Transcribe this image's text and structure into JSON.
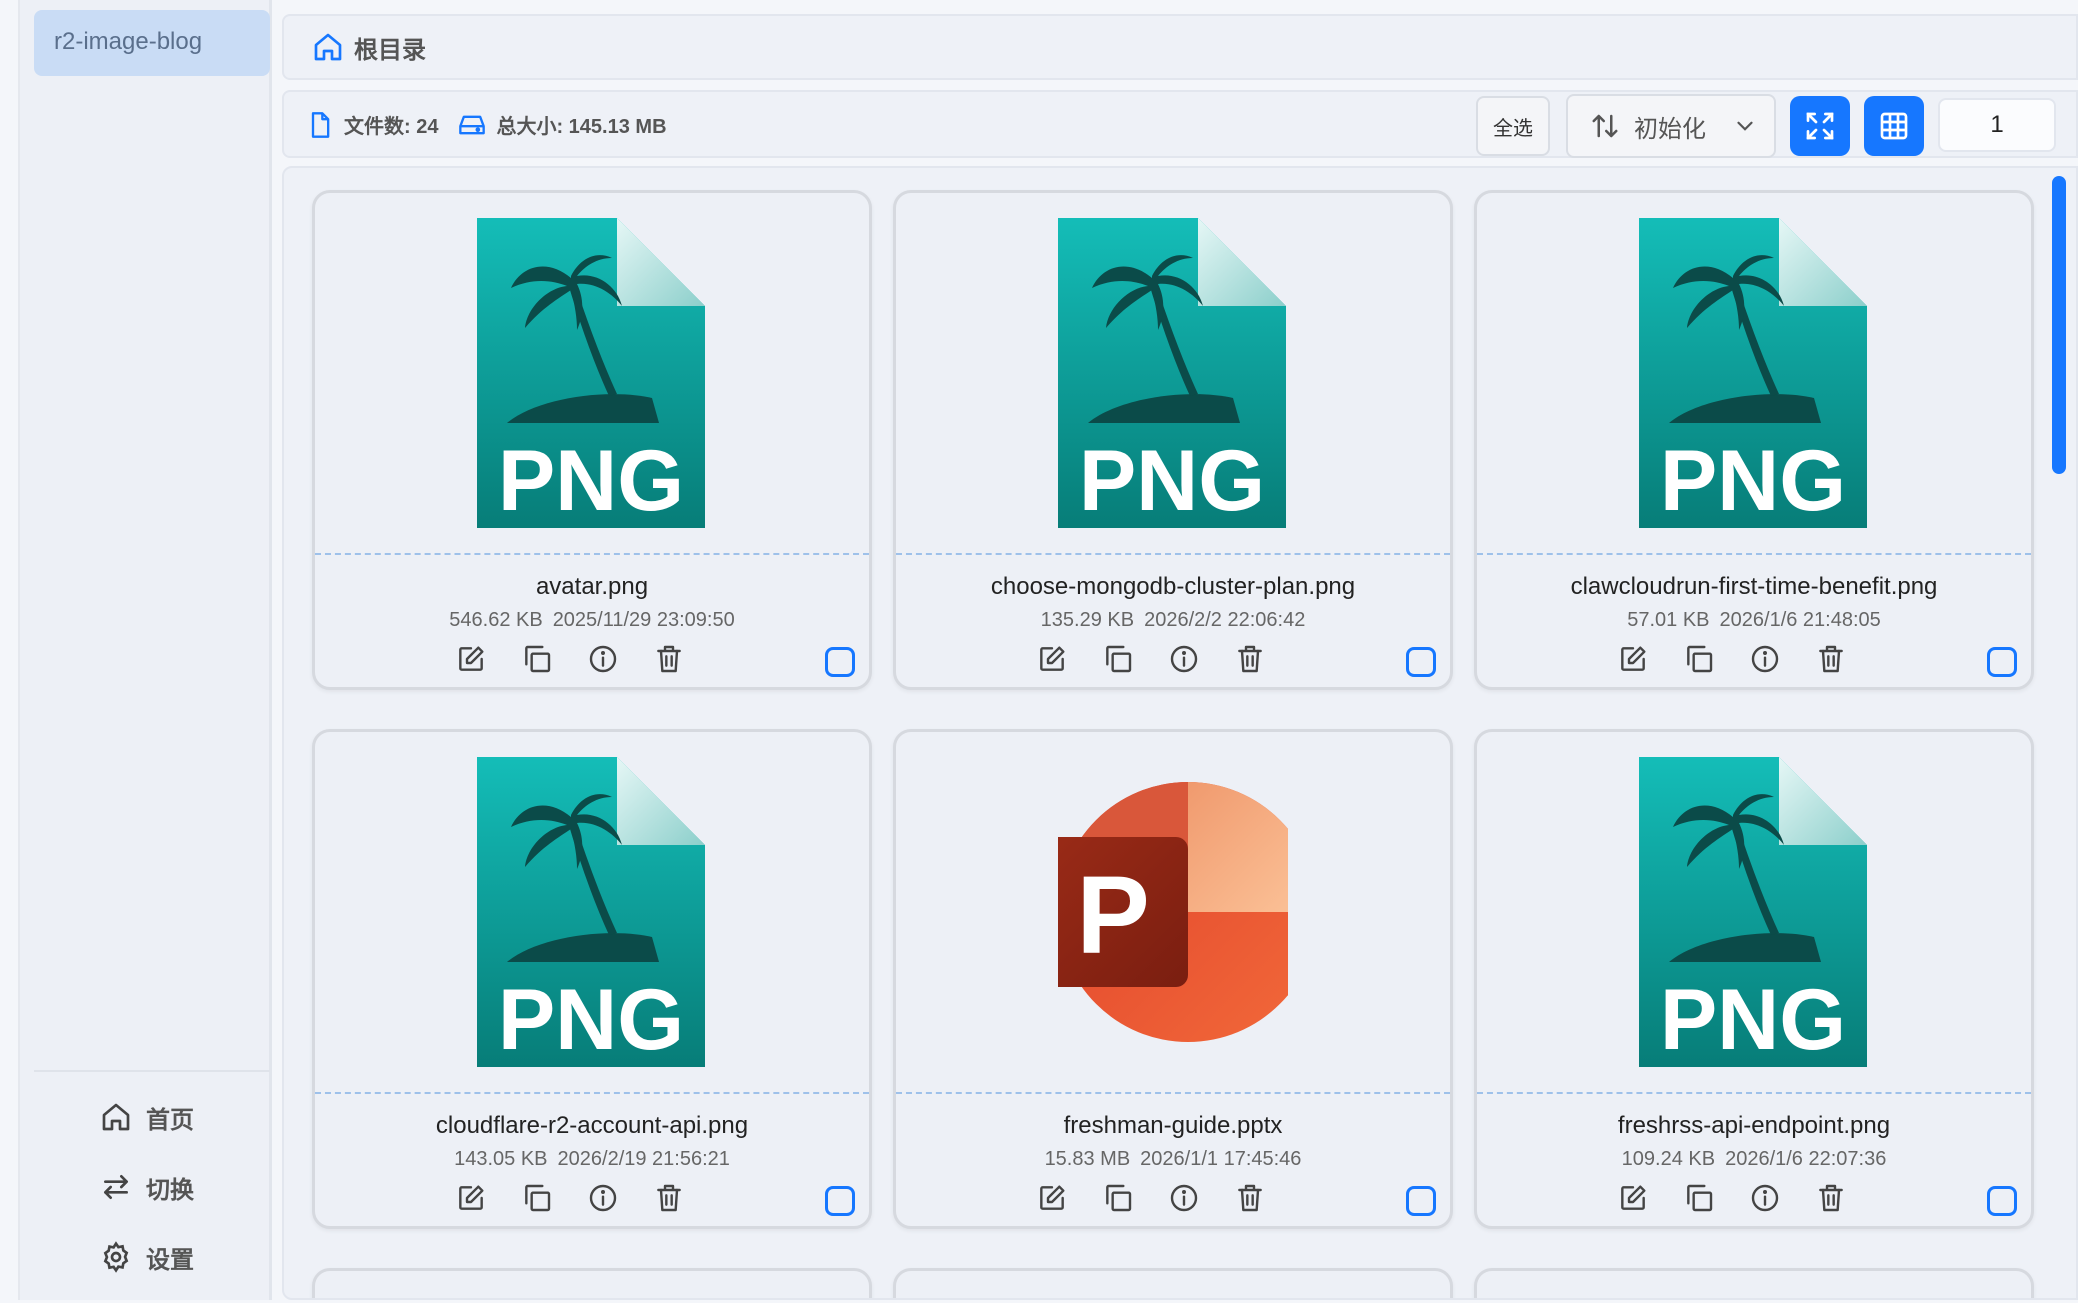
{
  "sidebar": {
    "bucket": "r2-image-blog",
    "nav": [
      {
        "label": "首页",
        "icon": "home-icon"
      },
      {
        "label": "切换",
        "icon": "switch-icon"
      },
      {
        "label": "设置",
        "icon": "gear-icon"
      }
    ]
  },
  "breadcrumb": {
    "root": "根目录"
  },
  "toolbar": {
    "file_count": "文件数: 24",
    "total_size": "总大小: 145.13 MB",
    "select_all": "全选",
    "sort_value": "初始化",
    "page_value": "1"
  },
  "files": [
    {
      "name": "avatar.png",
      "size": "546.62 KB",
      "time": "2025/11/29 23:09:50",
      "type": "png"
    },
    {
      "name": "choose-mongodb-cluster-plan.png",
      "size": "135.29 KB",
      "time": "2026/2/2 22:06:42",
      "type": "png"
    },
    {
      "name": "clawcloudrun-first-time-benefit.png",
      "size": "57.01 KB",
      "time": "2026/1/6 21:48:05",
      "type": "png"
    },
    {
      "name": "cloudflare-r2-account-api.png",
      "size": "143.05 KB",
      "time": "2026/2/19 21:56:21",
      "type": "png"
    },
    {
      "name": "freshman-guide.pptx",
      "size": "15.83 MB",
      "time": "2026/1/1 17:45:46",
      "type": "pptx"
    },
    {
      "name": "freshrss-api-endpoint.png",
      "size": "109.24 KB",
      "time": "2026/1/6 22:07:36",
      "type": "png"
    }
  ],
  "file_icon_text": {
    "png": "PNG",
    "pptx": "P"
  },
  "colors": {
    "accent": "#1677ff",
    "png_teal": "#12b5b0",
    "ppt_red": "#c43e1c"
  }
}
